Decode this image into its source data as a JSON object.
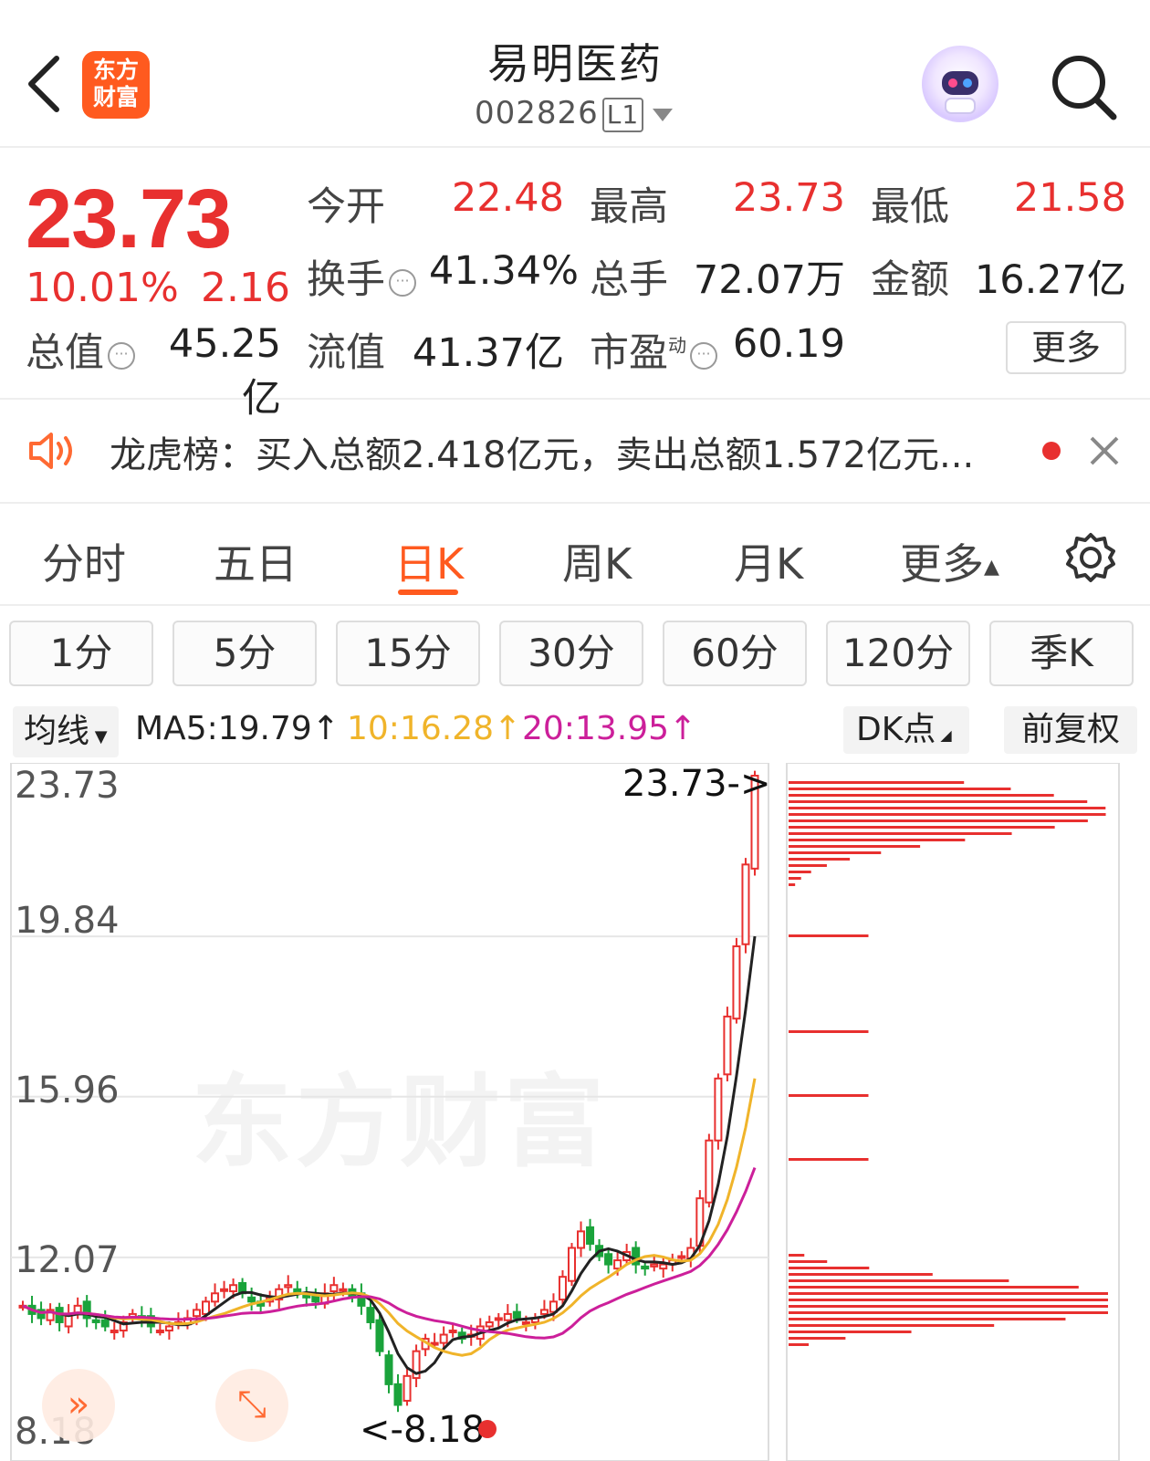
{
  "header": {
    "title": "易明医药",
    "code": "002826",
    "code_tag": "L1",
    "logo_text_1": "东方",
    "logo_text_2": "财富"
  },
  "quote": {
    "price": "23.73",
    "change_pct": "10.01%",
    "change": "2.16",
    "open_label": "今开",
    "open_value": "22.48",
    "high_label": "最高",
    "high_value": "23.73",
    "low_label": "最低",
    "low_value": "21.58",
    "turnover_label": "换手",
    "turnover_value": "41.34%",
    "volume_label": "总手",
    "volume_value": "72.07万",
    "amount_label": "金额",
    "amount_value": "16.27亿",
    "mktcap_label": "总值",
    "mktcap_value": "45.25亿",
    "float_label": "流值",
    "float_value": "41.37亿",
    "pe_label": "市盈",
    "pe_sup": "动",
    "pe_value": "60.19",
    "more_label": "更多"
  },
  "notice": {
    "text": "龙虎榜：买入总额2.418亿元，卖出总额1.572亿元..."
  },
  "tabs": {
    "items": [
      "分时",
      "五日",
      "日K",
      "周K",
      "月K",
      "更多"
    ],
    "active": "日K"
  },
  "periods": [
    "1分",
    "5分",
    "15分",
    "30分",
    "60分",
    "120分",
    "季K"
  ],
  "ma_bar": {
    "selector": "均线",
    "ma5": "MA5:19.79↑",
    "ma10": "10:16.28↑",
    "ma20": "20:13.95↑",
    "dk_label": "DK点",
    "adjust_label": "前复权"
  },
  "colors": {
    "up": "#e8302f",
    "down": "#1aa33b",
    "ma5": "#222222",
    "ma10": "#f0b42a",
    "ma20": "#cc1f9a",
    "accent": "#ff5a1f"
  },
  "chart_data": {
    "type": "candlestick",
    "y_ticks": [
      "23.73",
      "19.84",
      "15.96",
      "12.07",
      "8.18"
    ],
    "ylim": [
      8.18,
      23.73
    ],
    "high_marker": "23.73->",
    "low_marker": "<-8.18",
    "watermark": "东方财富",
    "close": [
      10.9,
      10.7,
      10.6,
      10.8,
      10.5,
      10.7,
      10.9,
      10.6,
      10.5,
      10.4,
      10.3,
      10.5,
      10.7,
      10.6,
      10.4,
      10.3,
      10.4,
      10.5,
      10.6,
      10.8,
      11.0,
      11.2,
      11.3,
      11.4,
      11.2,
      11.0,
      10.9,
      11.1,
      11.3,
      11.4,
      11.2,
      11.1,
      11.0,
      11.2,
      11.4,
      11.3,
      11.1,
      10.9,
      10.5,
      9.8,
      9.0,
      8.5,
      9.2,
      9.8,
      10.1,
      10.0,
      10.2,
      10.3,
      10.1,
      10.2,
      10.4,
      10.5,
      10.6,
      10.7,
      10.6,
      10.5,
      10.6,
      10.8,
      11.0,
      11.6,
      12.3,
      12.7,
      12.4,
      12.1,
      11.9,
      12.0,
      12.2,
      11.9,
      11.8,
      11.9,
      11.9,
      12.0,
      12.1,
      12.3,
      13.5,
      14.9,
      16.4,
      17.9,
      19.6,
      21.58,
      23.73
    ],
    "volume_profile_note": "chip distribution (relative)"
  }
}
